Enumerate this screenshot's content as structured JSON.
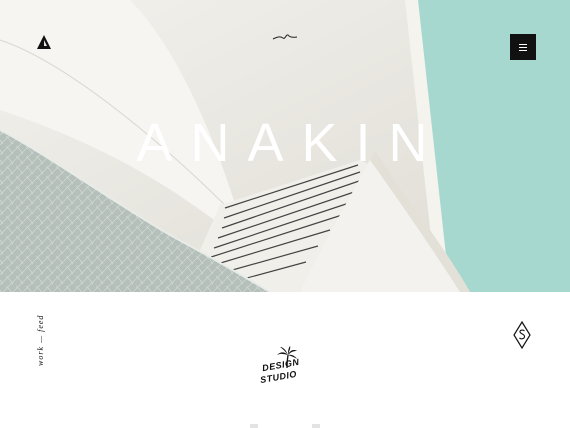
{
  "hero": {
    "title": "ANAKIN",
    "colors": {
      "sky": "#a6d8cf",
      "concrete": "#ece9e2",
      "mosaic": "#b9c3be",
      "ink": "#111111"
    }
  },
  "header": {
    "logo_icon": "triangle-logo-icon",
    "menu_icon": "hamburger-menu-icon",
    "signature_icon": "signature-scribble-icon"
  },
  "footer": {
    "side_label": "work — feed",
    "badge_icon": "diamond-s-badge-icon",
    "studio_logo": {
      "line1": "DESIGN",
      "line2": "STUDIO",
      "icon": "palm-tree-icon"
    }
  }
}
